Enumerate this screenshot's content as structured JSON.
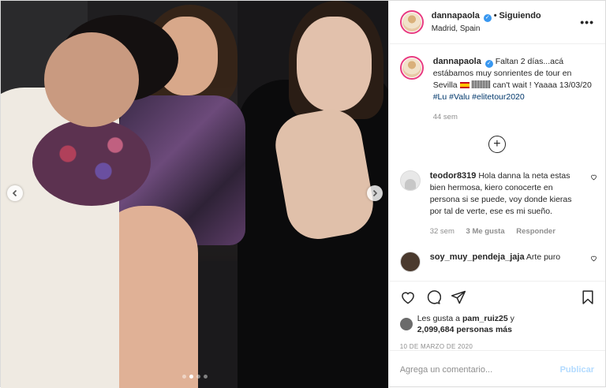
{
  "post": {
    "author": {
      "username": "dannapaola",
      "follow_sep": "•",
      "follow_label": "Siguiendo",
      "location": "Madrid, Spain",
      "more": "•••"
    },
    "caption": {
      "username": "dannapaola",
      "text_1": "Faltan 2 días...acá estábamos muy sonrientes de tour en Sevilla",
      "text_2": "can't wait ! Yaaaa 13/03/20",
      "tags": [
        "#Lu",
        "#Valu",
        "#elitetour2020"
      ],
      "time": "44 sem"
    },
    "comments": [
      {
        "username": "teodor8319",
        "text": "Hola danna la neta estas bien hermosa, kiero conocerte en persona si se puede, voy donde kieras por tal de verte, ese es mi sueño.",
        "time": "32 sem",
        "likes": "3 Me gusta",
        "reply": "Responder"
      },
      {
        "username": "soy_muy_pendeja_jaja",
        "text": "Arte puro"
      }
    ],
    "likes": {
      "prefix": "Les gusta a",
      "user": "pam_ruiz25",
      "mid": "y",
      "count": "2,099,684 personas más"
    },
    "date": "10 DE MARZO DE 2020",
    "add_comment_placeholder": "Agrega un comentario...",
    "publish_label": "Publicar",
    "carousel": {
      "slides": 4,
      "active_index": 1
    }
  }
}
